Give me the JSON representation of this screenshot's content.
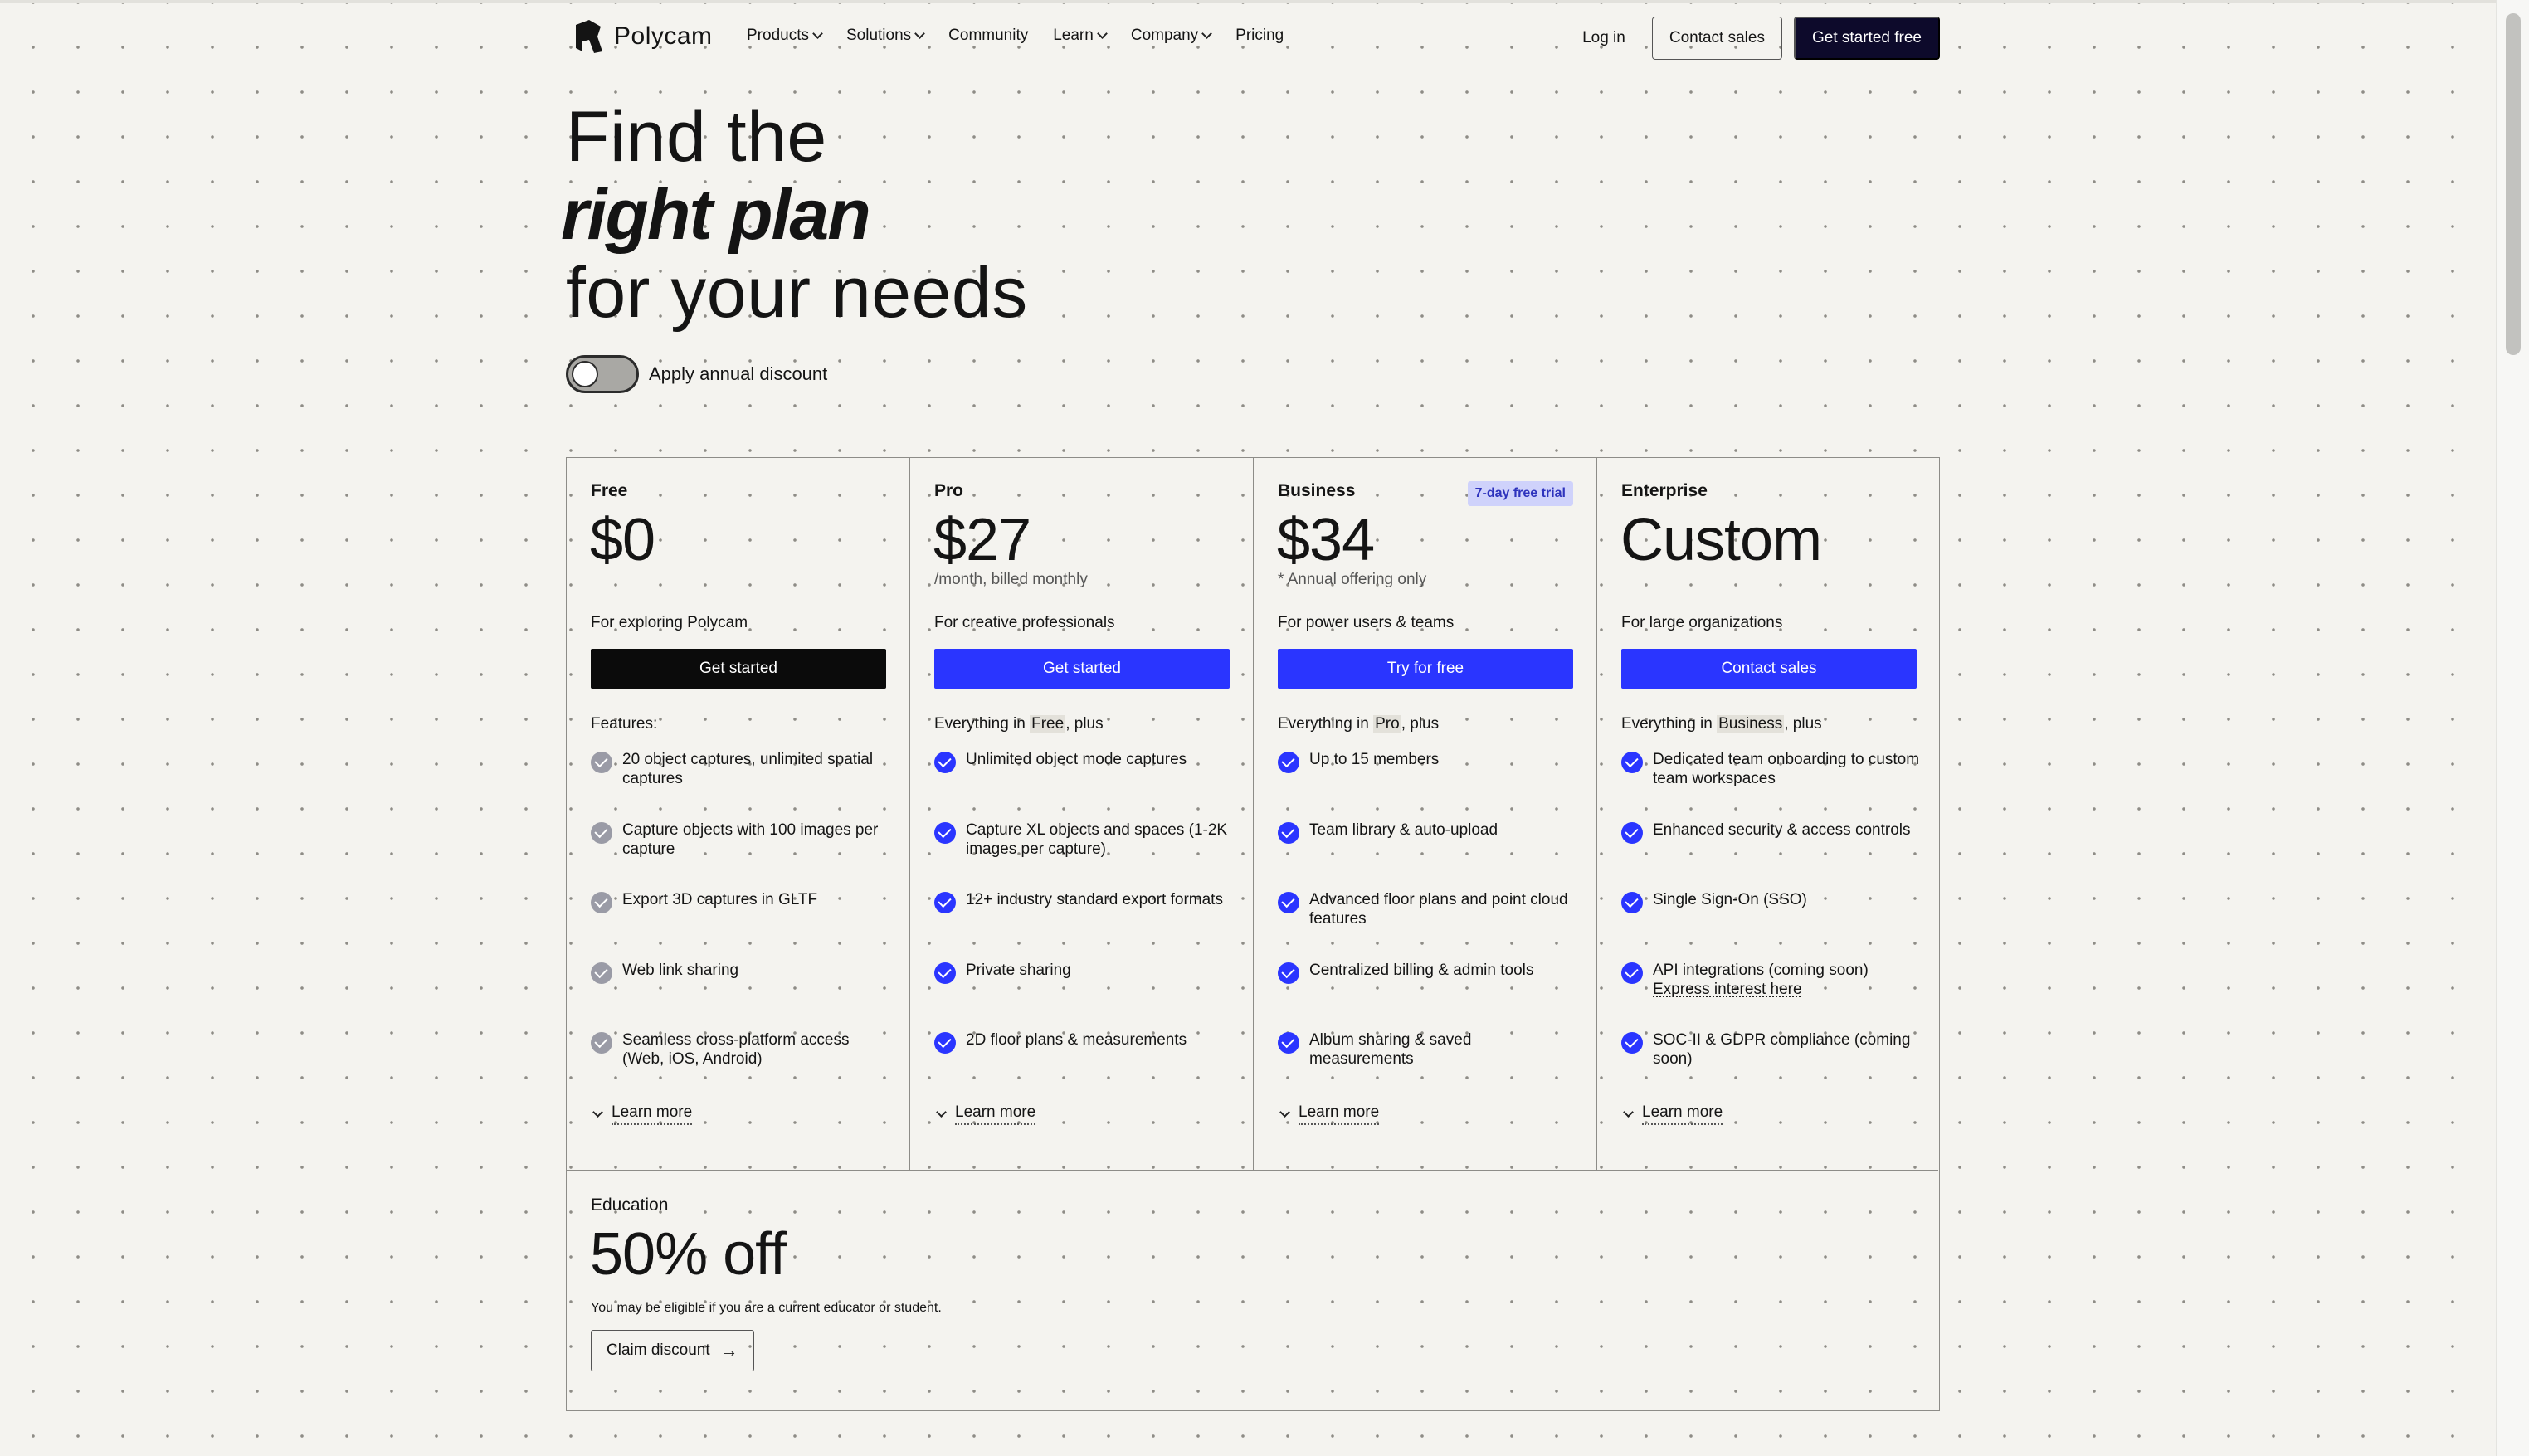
{
  "nav": {
    "logo_text": "Polycam",
    "links": [
      {
        "label": "Products",
        "dropdown": true
      },
      {
        "label": "Solutions",
        "dropdown": true
      },
      {
        "label": "Community",
        "dropdown": false
      },
      {
        "label": "Learn",
        "dropdown": true
      },
      {
        "label": "Company",
        "dropdown": true
      },
      {
        "label": "Pricing",
        "dropdown": false
      }
    ],
    "login": "Log in",
    "contact_sales": "Contact sales",
    "get_started": "Get started free"
  },
  "hero": {
    "line1": "Find the",
    "line2": "right plan",
    "line3": "for your needs"
  },
  "toggle": {
    "label": "Apply annual discount",
    "on": false
  },
  "plans": [
    {
      "name": "Free",
      "badge": "",
      "price": "$0",
      "price_note": "",
      "tagline": "For exploring Polycam",
      "cta": "Get started",
      "cta_style": "dark",
      "features_heading_pre": "Features:",
      "features_heading_ref": "",
      "features_heading_post": "",
      "check_style": "grey",
      "features": [
        {
          "text": "20 object captures, unlimited spatial captures",
          "link": ""
        },
        {
          "text": "Capture objects with 100 images per capture",
          "link": ""
        },
        {
          "text": "Export 3D captures in GLTF",
          "link": ""
        },
        {
          "text": "Web link sharing",
          "link": ""
        },
        {
          "text": "Seamless cross-platform access (Web, iOS, Android)",
          "link": ""
        }
      ],
      "learn_more": "Learn more"
    },
    {
      "name": "Pro",
      "badge": "",
      "price": "$27",
      "price_note": "/month, billed monthly",
      "tagline": "For creative professionals",
      "cta": "Get started",
      "cta_style": "blue",
      "features_heading_pre": "Everything in ",
      "features_heading_ref": "Free",
      "features_heading_post": ", plus",
      "check_style": "blue",
      "features": [
        {
          "text": "Unlimited object mode captures",
          "link": ""
        },
        {
          "text": "Capture XL objects and spaces (1-2K images per capture)",
          "link": ""
        },
        {
          "text": "12+ industry standard export formats",
          "link": ""
        },
        {
          "text": "Private sharing",
          "link": ""
        },
        {
          "text": "2D floor plans & measurements",
          "link": ""
        }
      ],
      "learn_more": "Learn more"
    },
    {
      "name": "Business",
      "badge": "7-day free trial",
      "price": "$34",
      "price_note": "* Annual offering only",
      "tagline": "For power users & teams",
      "cta": "Try for free",
      "cta_style": "blue",
      "features_heading_pre": "Everything in ",
      "features_heading_ref": "Pro",
      "features_heading_post": ", plus",
      "check_style": "blue",
      "features": [
        {
          "text": "Up to 15 members",
          "link": ""
        },
        {
          "text": "Team library & auto-upload",
          "link": ""
        },
        {
          "text": "Advanced floor plans and point cloud features",
          "link": ""
        },
        {
          "text": "Centralized billing & admin tools",
          "link": ""
        },
        {
          "text": "Album sharing & saved measurements",
          "link": ""
        }
      ],
      "learn_more": "Learn more"
    },
    {
      "name": "Enterprise",
      "badge": "",
      "price": "Custom",
      "price_note": "",
      "tagline": "For large organizations",
      "cta": "Contact sales",
      "cta_style": "blue",
      "features_heading_pre": "Everything in ",
      "features_heading_ref": "Business",
      "features_heading_post": ", plus",
      "check_style": "blue",
      "features": [
        {
          "text": "Dedicated team onboarding to custom team workspaces",
          "link": ""
        },
        {
          "text": "Enhanced security & access controls",
          "link": ""
        },
        {
          "text": "Single Sign-On (SSO)",
          "link": ""
        },
        {
          "text": "API integrations (coming soon)",
          "link": "Express interest here"
        },
        {
          "text": "SOC-II & GDPR compliance (coming soon)",
          "link": ""
        }
      ],
      "learn_more": "Learn more"
    }
  ],
  "education": {
    "title": "Education",
    "price": "50% off",
    "note": "You may be eligible if you are a current educator or student.",
    "cta": "Claim discount",
    "cta_arrow": "→"
  },
  "colors": {
    "accent_blue": "#2a35ff",
    "nav_button_dark": "#0d0a2b",
    "badge_bg": "#cfd2fb",
    "badge_text": "#2e33bd",
    "free_check": "#9a9ba6"
  }
}
